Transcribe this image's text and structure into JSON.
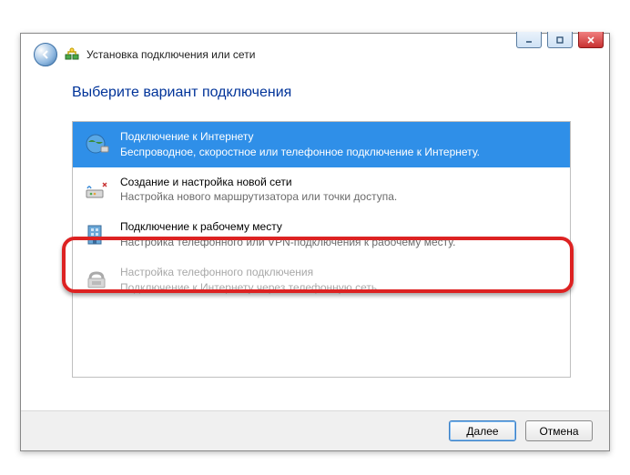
{
  "window": {
    "title": "Установка подключения или сети"
  },
  "heading": "Выберите вариант подключения",
  "options": [
    {
      "title": "Подключение к Интернету",
      "desc": "Беспроводное, скоростное или телефонное подключение к Интернету."
    },
    {
      "title": "Создание и настройка новой сети",
      "desc": "Настройка нового маршрутизатора или точки доступа."
    },
    {
      "title": "Подключение к рабочему месту",
      "desc": "Настройка телефонного или VPN-подключения к рабочему месту."
    },
    {
      "title": "Настройка телефонного подключения",
      "desc": "Подключение к Интернету через телефонную сеть."
    }
  ],
  "footer": {
    "next": "Далее",
    "cancel": "Отмена"
  }
}
